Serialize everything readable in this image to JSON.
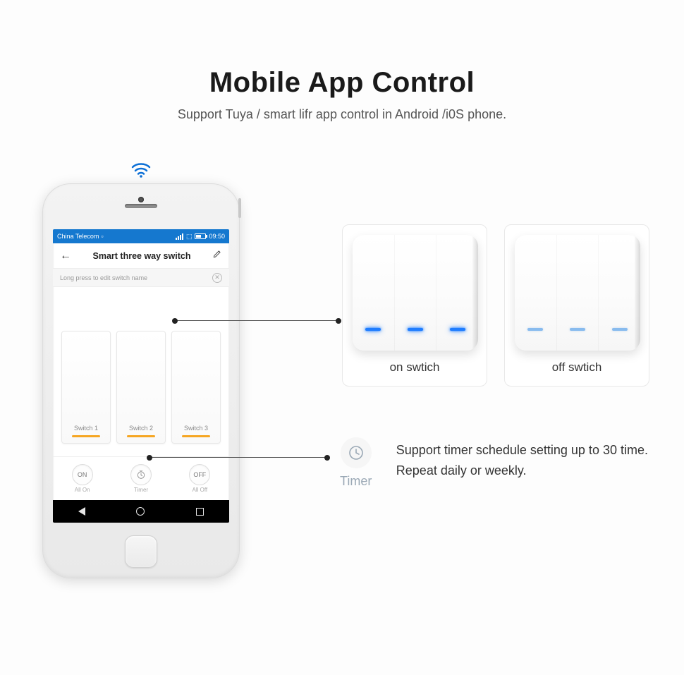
{
  "header": {
    "title": "Mobile App Control",
    "subtitle": "Support Tuya / smart lifr app control in Android /i0S phone."
  },
  "phone": {
    "status": {
      "carrier": "China Telecom",
      "time": "09:50"
    },
    "app_bar": {
      "title": "Smart three way switch"
    },
    "hint": {
      "text": "Long press to edit switch name"
    },
    "switches": [
      {
        "label": "Switch 1"
      },
      {
        "label": "Switch 2"
      },
      {
        "label": "Switch 3"
      }
    ],
    "actions": {
      "all_on": {
        "btn": "ON",
        "label": "All On"
      },
      "timer": {
        "btn": "⏱",
        "label": "Timer"
      },
      "all_off": {
        "btn": "OFF",
        "label": "All Off"
      }
    }
  },
  "panels": {
    "on": {
      "caption": "on swtich"
    },
    "off": {
      "caption": "off swtich"
    }
  },
  "timer": {
    "label": "Timer",
    "desc": "Support timer schedule setting up to 30 time. Repeat daily or weekly."
  }
}
